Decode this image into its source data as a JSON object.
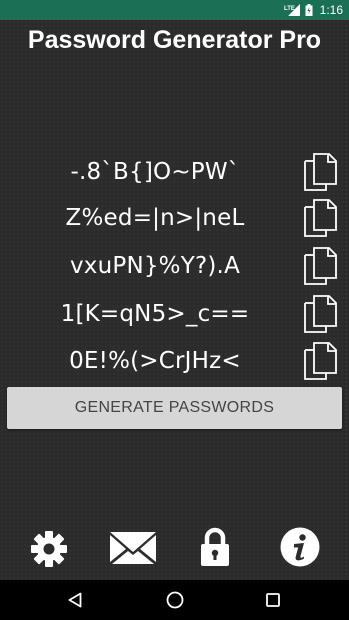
{
  "status_bar": {
    "network": "LTE",
    "time": "1:16"
  },
  "app": {
    "title": "Password Generator Pro"
  },
  "passwords": [
    "-.8`B{]O~PW`",
    "Z%ed=|n>|neL",
    "vxuPN}%Y?).A",
    "1[K=qN5>_c==",
    "0E!%(>CrJHz<"
  ],
  "actions": {
    "generate_label": "GENERATE PASSWORDS"
  },
  "bottom_toolbar": {
    "icons": [
      "gear-icon",
      "envelope-icon",
      "lock-icon",
      "info-icon"
    ]
  },
  "nav_bar": {
    "icons": [
      "back-icon",
      "home-icon",
      "recents-icon"
    ]
  },
  "colors": {
    "status_bar": "#1a6f54",
    "background": "#2b2b2b",
    "button": "#d6d6d6",
    "button_text": "#444444",
    "text": "#ffffff"
  }
}
